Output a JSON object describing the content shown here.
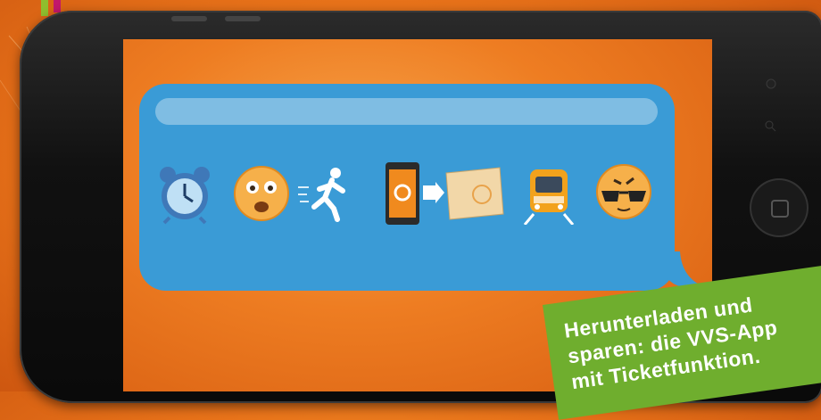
{
  "message": {
    "emojis": [
      {
        "name": "alarm-clock"
      },
      {
        "name": "shocked-face"
      },
      {
        "name": "running-person"
      },
      {
        "name": "phone-to-ticket"
      },
      {
        "name": "tram"
      },
      {
        "name": "cool-face"
      }
    ]
  },
  "banner": {
    "line1": "Herunterladen und",
    "line2": "sparen: die VVS-App",
    "line3": "mit Ticketfunktion."
  },
  "colors": {
    "background": "#e8731a",
    "bubble": "#3a9bd6",
    "banner": "#6fae2e"
  }
}
